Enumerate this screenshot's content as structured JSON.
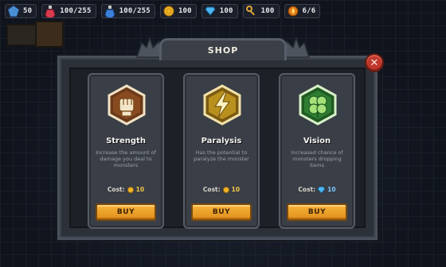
{
  "hud": {
    "level": "50",
    "health": "100/255",
    "mana": "100/255",
    "gold": "100",
    "gems": "100",
    "keys": "100",
    "orbs": "6/6"
  },
  "shop": {
    "title": "SHOP",
    "cards": [
      {
        "name": "Strength",
        "desc": "Increase the amount of damage you deal to monsters",
        "cost_label": "Cost:",
        "cost_value": "10",
        "currency": "gold",
        "buy_label": "BUY"
      },
      {
        "name": "Paralysis",
        "desc": "Has the potential to paralyze the monster",
        "cost_label": "Cost:",
        "cost_value": "10",
        "currency": "gold",
        "buy_label": "BUY"
      },
      {
        "name": "Vision",
        "desc": "Increased chance of monsters dropping items",
        "cost_label": "Cost:",
        "cost_value": "10",
        "currency": "gem",
        "buy_label": "BUY"
      }
    ]
  },
  "colors": {
    "accent": "#f2a52c",
    "close": "#c0392b",
    "frame": "#2c3038"
  }
}
